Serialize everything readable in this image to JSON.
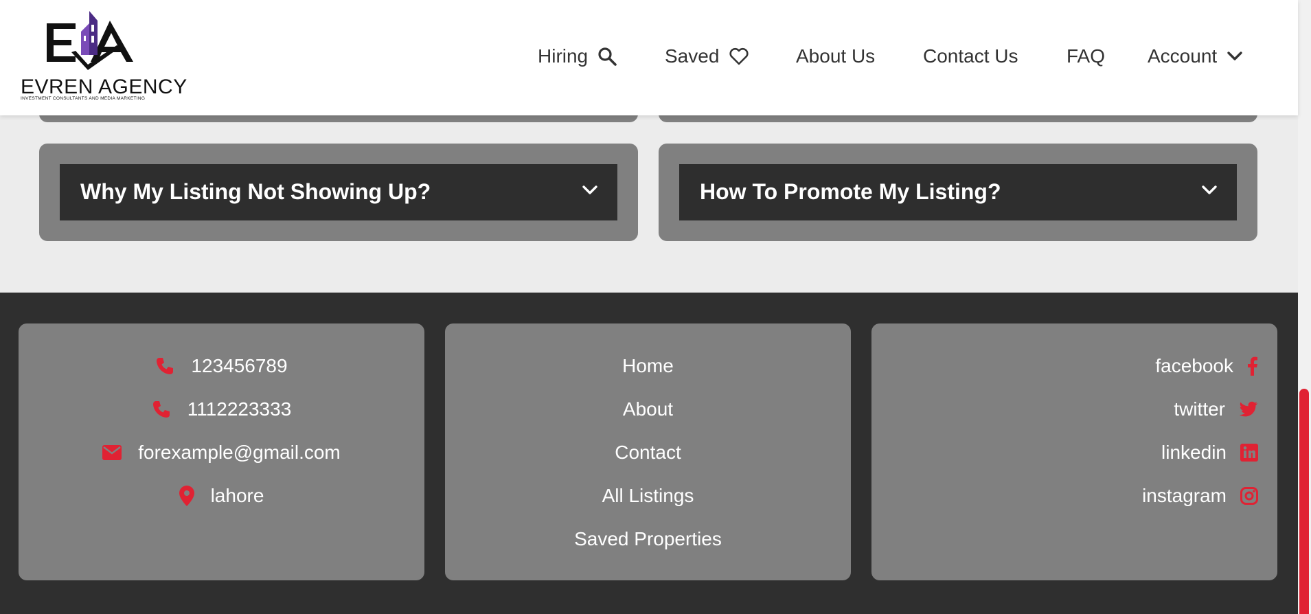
{
  "brand": {
    "name": "EVREN AGENCY",
    "tagline": "INVESTMENT CONSULTANTS AND MEDIA MARKETING",
    "accent": "#6a3aa0"
  },
  "nav": {
    "hiring": "Hiring",
    "saved": "Saved",
    "about": "About Us",
    "contact": "Contact Us",
    "faq": "FAQ",
    "account": "Account"
  },
  "faq": {
    "items": [
      {
        "question": "Why My Listing Not Showing Up?"
      },
      {
        "question": "How To Promote My Listing?"
      }
    ]
  },
  "footer": {
    "contact": {
      "phone1": "123456789",
      "phone2": "1112223333",
      "email": "forexample@gmail.com",
      "location": "lahore"
    },
    "links": [
      "Home",
      "About",
      "Contact",
      "All Listings",
      "Saved Properties"
    ],
    "social": [
      "facebook",
      "twitter",
      "linkedin",
      "instagram"
    ]
  },
  "colors": {
    "icon_red": "#e02233",
    "card_gray": "#808080",
    "dark": "#2f2f2f"
  }
}
